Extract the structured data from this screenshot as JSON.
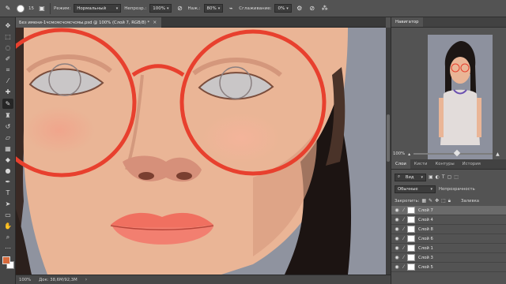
{
  "options_bar": {
    "brush_size": "15",
    "mode_label": "Режим:",
    "mode_value": "Нормальный",
    "opacity_label": "Непрозр.:",
    "opacity_value": "100%",
    "pressure_label": "Наж.:",
    "pressure_value": "80%",
    "smoothing_label": "Сглаживание:",
    "smoothing_value": "0%"
  },
  "document_tab": {
    "title": "Без имени-1чсмсмсчсмсчсмы.psd @ 100% (Слой 7, RGB/8) *",
    "close": "×"
  },
  "status_bar": {
    "zoom": "100%",
    "doc_info": "Док: 38,6M/92,3M",
    "arrow": "›"
  },
  "colors": {
    "foreground": "#d76a3c",
    "background": "#ffffff",
    "glasses_stroke": "#e8402e"
  },
  "navigator": {
    "tab": "Навигатор",
    "zoom": "100%",
    "zoom_fraction": 0.55
  },
  "layers_panel": {
    "tabs": [
      "Слои",
      "Кисти",
      "Контуры",
      "История"
    ],
    "filter_label": "Вид",
    "blend_mode": "Обычные",
    "opacity_label": "Непрозрачность",
    "lock_label": "Закрепить:",
    "fill_label": "Заливка",
    "layers": [
      {
        "name": "Слой 7",
        "selected": true
      },
      {
        "name": "Слой 4",
        "selected": false
      },
      {
        "name": "Слой 8",
        "selected": false
      },
      {
        "name": "Слой 6",
        "selected": false
      },
      {
        "name": "Слой 1",
        "selected": false
      },
      {
        "name": "Слой 3",
        "selected": false
      },
      {
        "name": "Слой 5",
        "selected": false
      }
    ]
  },
  "toolbox": {
    "tools": [
      "move-icon",
      "marquee-icon",
      "lasso-icon",
      "quick-select-icon",
      "crop-icon",
      "eyedropper-icon",
      "healing-icon",
      "brush-icon",
      "stamp-icon",
      "history-brush-icon",
      "eraser-icon",
      "gradient-icon",
      "blur-icon",
      "dodge-icon",
      "pen-icon",
      "type-icon",
      "path-select-icon",
      "shape-icon",
      "hand-icon",
      "zoom-icon",
      "more-icon"
    ]
  }
}
